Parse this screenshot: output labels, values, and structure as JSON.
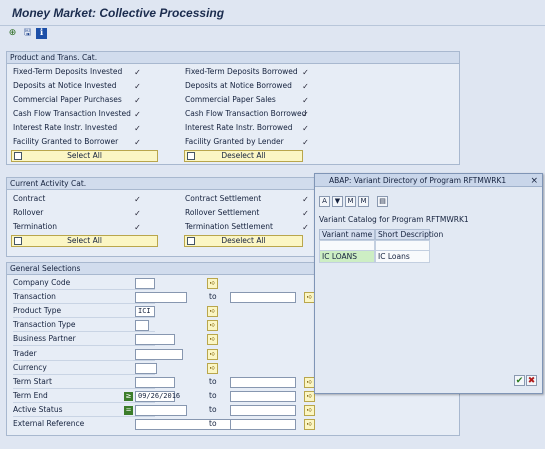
{
  "window": {
    "title": "Money Market: Collective Processing"
  },
  "toolbar": {
    "execute": "⊕",
    "save": "🖫",
    "info": "ℹ"
  },
  "product": {
    "header": "Product and Trans. Cat.",
    "left": [
      "Fixed-Term Deposits Invested",
      "Deposits at Notice Invested",
      "Commercial Paper Purchases",
      "Cash Flow Transaction Invested",
      "Interest Rate Instr. Invested",
      "Facility Granted to Borrower"
    ],
    "right": [
      "Fixed-Term Deposits Borrowed",
      "Deposits at Notice Borrowed",
      "Commercial Paper Sales",
      "Cash Flow Transaction Borrowed",
      "Interest Rate Instr. Borrowed",
      "Facility Granted by Lender"
    ],
    "select_all": "Select All",
    "deselect_all": "Deselect All"
  },
  "activity": {
    "header": "Current Activity Cat.",
    "left": [
      "Contract",
      "Rollover",
      "Termination"
    ],
    "right": [
      "Contract Settlement",
      "Rollover Settlement",
      "Termination Settlement"
    ],
    "select_all": "Select All",
    "deselect_all": "Deselect All"
  },
  "general": {
    "header": "General Selections",
    "to": "to",
    "fields": [
      {
        "label": "Company Code",
        "value": ""
      },
      {
        "label": "Transaction",
        "value": ""
      },
      {
        "label": "Product Type",
        "value": "ICI"
      },
      {
        "label": "Transaction Type",
        "value": ""
      },
      {
        "label": "Business Partner",
        "value": ""
      },
      {
        "label": "Trader",
        "value": ""
      },
      {
        "label": "Currency",
        "value": ""
      },
      {
        "label": "Term Start",
        "value": ""
      },
      {
        "label": "Term End",
        "value": "09/26/2016"
      },
      {
        "label": "Active Status",
        "value": ""
      },
      {
        "label": "External Reference",
        "value": ""
      }
    ]
  },
  "dialog": {
    "title": "ABAP: Variant Directory of Program RFTMWRK1",
    "catalog": "Variant Catalog for Program RFTMWRK1",
    "col_variant": "Variant name",
    "col_desc": "Short Description",
    "rows": [
      {
        "name": "IC LOANS",
        "desc": "IC Loans"
      }
    ],
    "ok": "✔",
    "cancel": "✖",
    "close": "×"
  },
  "colors": {
    "bg": "#dfe6f2",
    "button": "#fbf6c4",
    "selected_row": "#cdeec4"
  }
}
